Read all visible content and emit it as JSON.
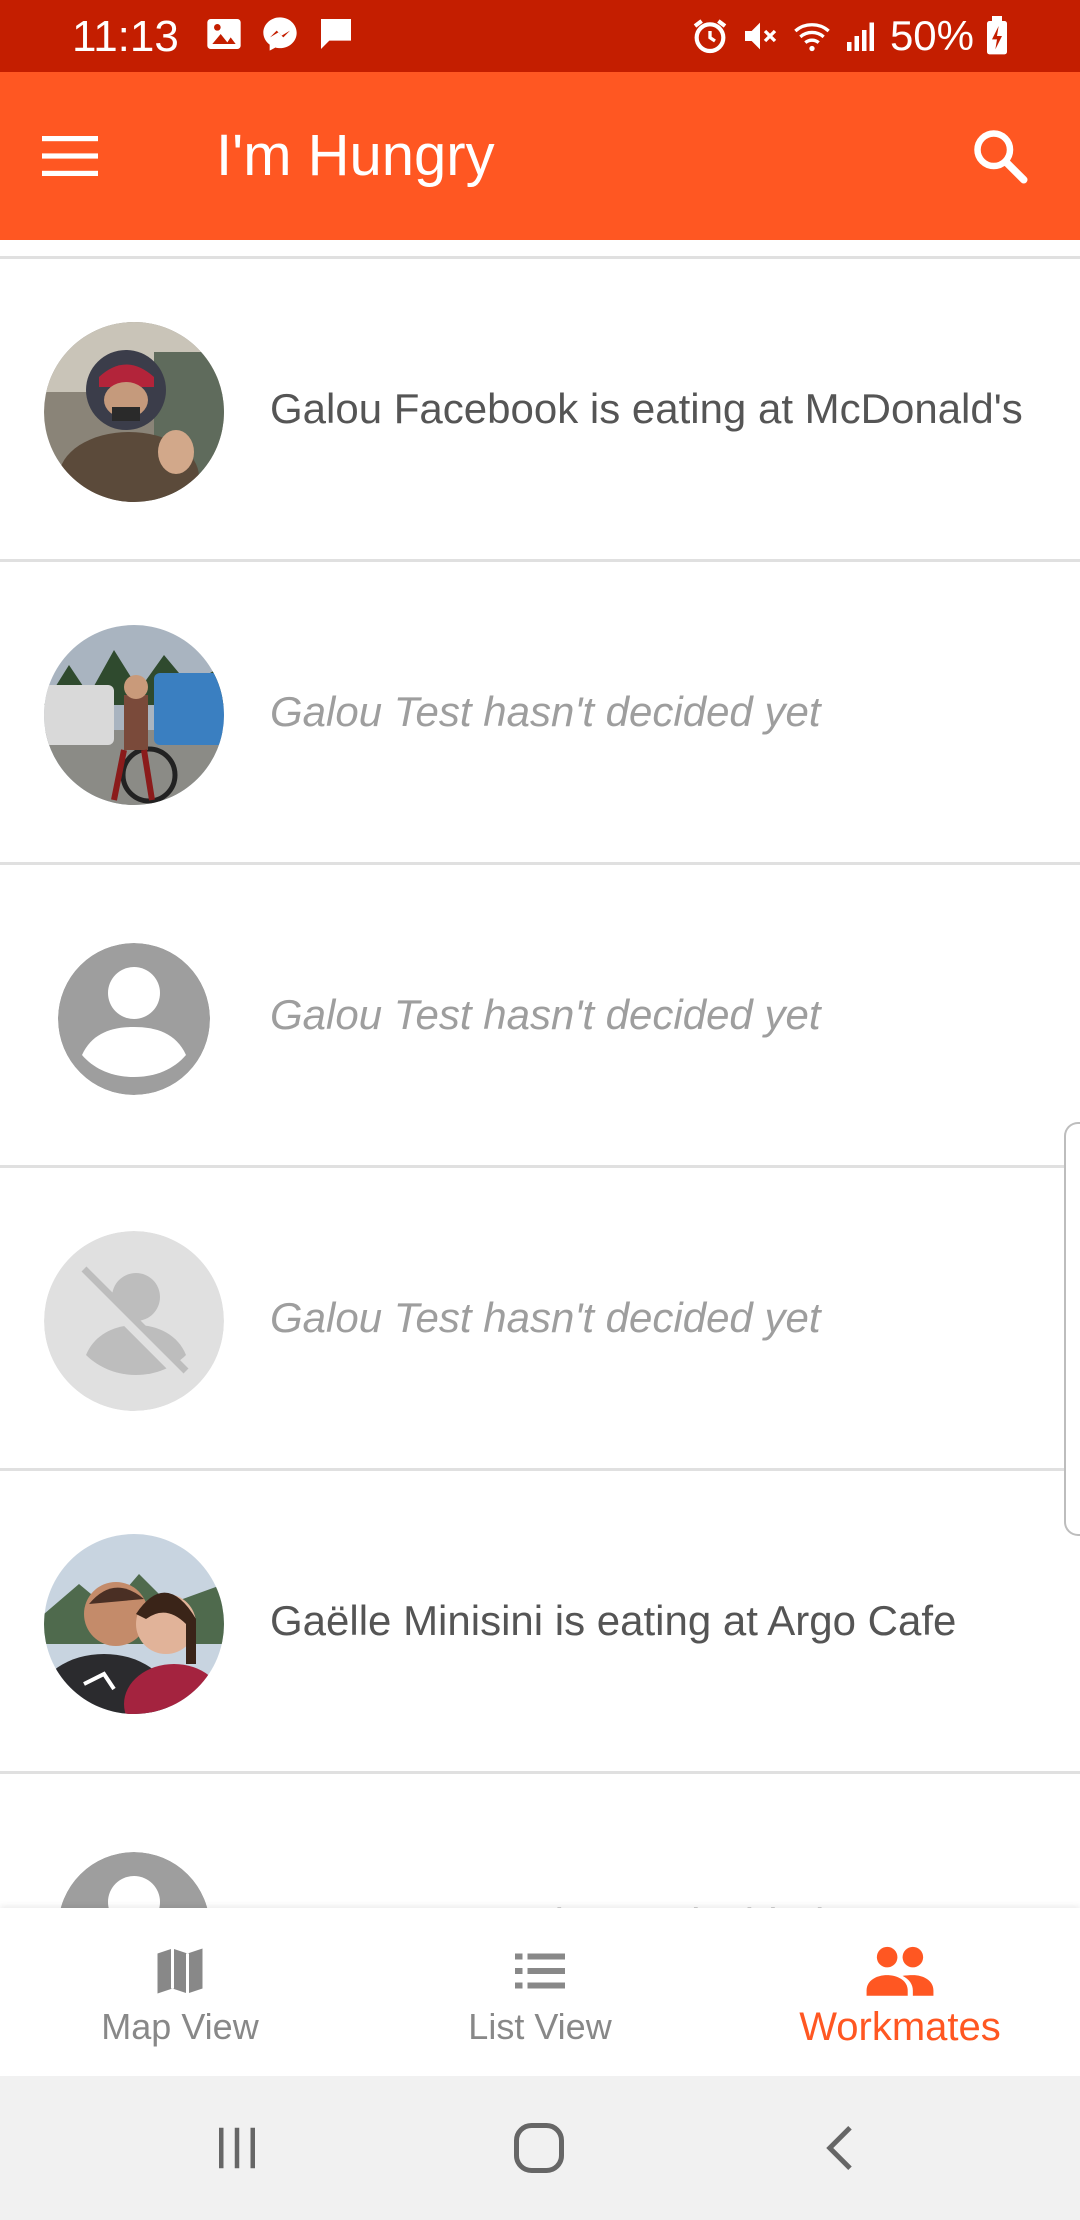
{
  "status_bar": {
    "time": "11:13",
    "battery": "50%",
    "left_icons": [
      "image-icon",
      "messenger-icon",
      "chat-icon"
    ],
    "right_icons": [
      "alarm-icon",
      "mute-icon",
      "wifi-icon",
      "signal-icon",
      "battery-charging-icon"
    ]
  },
  "app_bar": {
    "title": "I'm Hungry",
    "menu_icon": "hamburger-menu-icon",
    "search_icon": "search-icon",
    "color": "#ff5722",
    "status_color": "#c41e00"
  },
  "workmates": [
    {
      "text": "Galou Facebook is eating at McDonald's",
      "decided": true,
      "avatar": "photo"
    },
    {
      "text": "Galou Test hasn't decided yet",
      "decided": false,
      "avatar": "photo"
    },
    {
      "text": "Galou Test hasn't decided yet",
      "decided": false,
      "avatar": "default-person-icon"
    },
    {
      "text": "Galou Test hasn't decided yet",
      "decided": false,
      "avatar": "broken-image-icon"
    },
    {
      "text": "Gaëlle Minisini is eating at Argo Cafe",
      "decided": true,
      "avatar": "photo"
    },
    {
      "text": "New Test New hasn't decided yet",
      "decided": false,
      "avatar": "default-person-icon"
    }
  ],
  "bottom_nav": {
    "items": [
      {
        "label": "Map View",
        "icon": "map-icon",
        "active": false
      },
      {
        "label": "List View",
        "icon": "list-icon",
        "active": false
      },
      {
        "label": "Workmates",
        "icon": "people-icon",
        "active": true
      }
    ]
  },
  "system_nav": {
    "buttons": [
      "recents-icon",
      "home-icon",
      "back-icon"
    ]
  }
}
